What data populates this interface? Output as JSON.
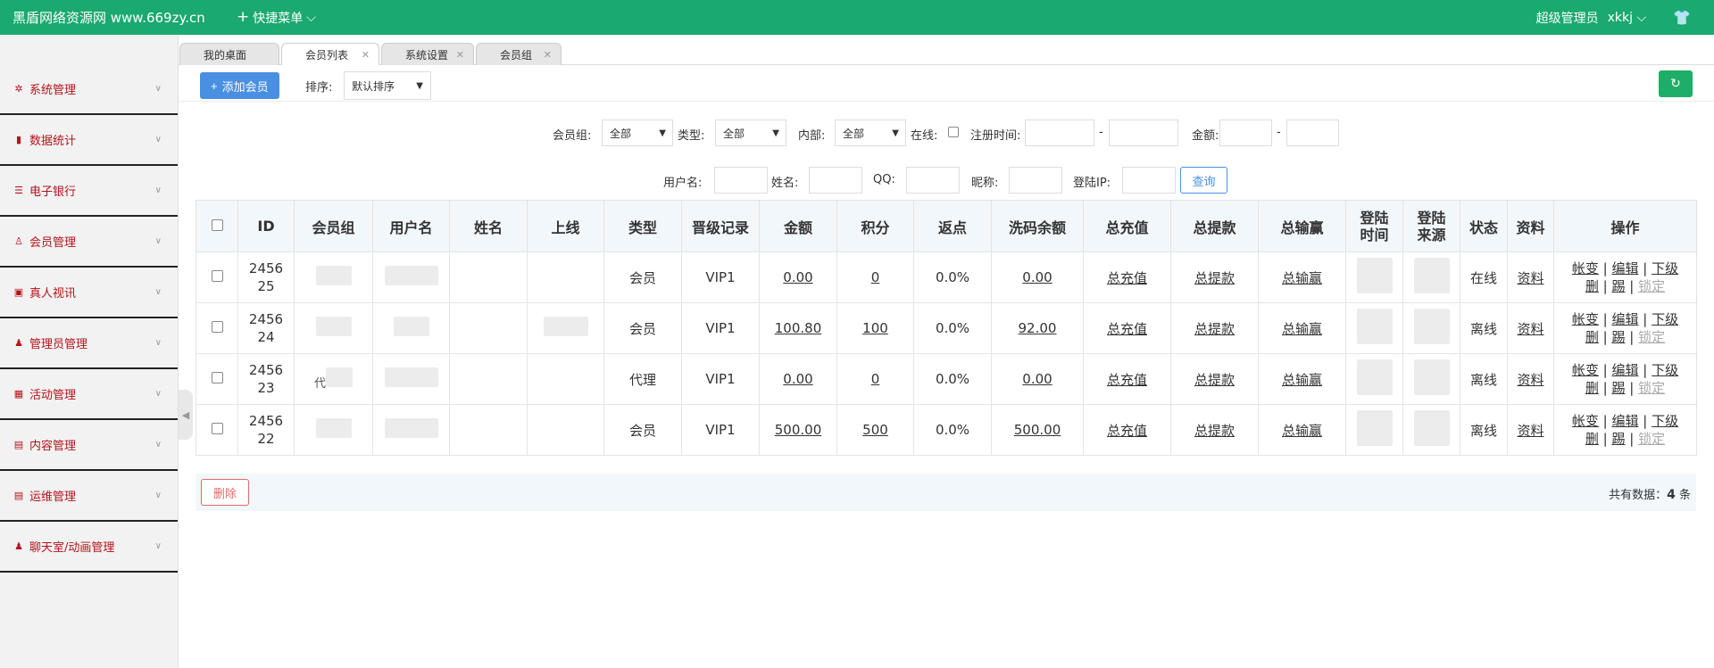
{
  "header": {
    "brand": "黑盾网络资源网 www.669zy.cn",
    "quick_menu": "快捷菜单",
    "role": "超级管理员",
    "username": "xkkj",
    "accent_color": "#1aa96e"
  },
  "sidebar": {
    "items": [
      {
        "label": "系统管理",
        "icon": "gear-icon"
      },
      {
        "label": "数据统计",
        "icon": "bar-chart-icon"
      },
      {
        "label": "电子银行",
        "icon": "list-icon"
      },
      {
        "label": "会员管理",
        "icon": "user-icon"
      },
      {
        "label": "真人视讯",
        "icon": "video-icon"
      },
      {
        "label": "管理员管理",
        "icon": "admin-icon"
      },
      {
        "label": "活动管理",
        "icon": "gift-icon"
      },
      {
        "label": "内容管理",
        "icon": "document-icon"
      },
      {
        "label": "运维管理",
        "icon": "server-icon"
      },
      {
        "label": "聊天室/动画管理",
        "icon": "chat-icon"
      }
    ]
  },
  "tabs": [
    {
      "label": "我的桌面"
    },
    {
      "label": "会员列表"
    },
    {
      "label": "系统设置"
    },
    {
      "label": "会员组"
    }
  ],
  "toolbar": {
    "add_label": "添加会员",
    "sort_label": "排序:",
    "sort_value": "默认排序"
  },
  "filters": {
    "group_label": "会员组:",
    "group_value": "全部",
    "type_label": "类型:",
    "type_value": "全部",
    "internal_label": "内部:",
    "internal_value": "全部",
    "online_label": "在线:",
    "regtime_label": "注册时间:",
    "dash": "-",
    "amount_label": "金额:",
    "username_label": "用户名:",
    "name_label": "姓名:",
    "qq_label": "QQ:",
    "nickname_label": "昵称:",
    "loginip_label": "登陆IP:",
    "query_label": "查询"
  },
  "table": {
    "headers": [
      "ID",
      "会员组",
      "用户名",
      "姓名",
      "上线",
      "类型",
      "晋级记录",
      "金额",
      "积分",
      "返点",
      "洗码余额",
      "总充值",
      "总提款",
      "总输赢",
      "登陆时间",
      "登陆来源",
      "状态",
      "资料",
      "操作"
    ],
    "rows": [
      {
        "id": "245625",
        "type": "会员",
        "level": "VIP1",
        "amount": "0.00",
        "points": "0",
        "rebate": "0.0%",
        "wash": "0.00",
        "recharge": "总充值",
        "withdraw": "总提款",
        "winloss": "总输赢",
        "status": "在线",
        "profile": "资料"
      },
      {
        "id": "245624",
        "type": "会员",
        "level": "VIP1",
        "amount": "100.80",
        "points": "100",
        "rebate": "0.0%",
        "wash": "92.00",
        "recharge": "总充值",
        "withdraw": "总提款",
        "winloss": "总输赢",
        "status": "离线",
        "profile": "资料"
      },
      {
        "id": "245623",
        "type": "代理",
        "level": "VIP1",
        "amount": "0.00",
        "points": "0",
        "rebate": "0.0%",
        "wash": "0.00",
        "recharge": "总充值",
        "withdraw": "总提款",
        "winloss": "总输赢",
        "status": "离线",
        "profile": "资料"
      },
      {
        "id": "245622",
        "type": "会员",
        "level": "VIP1",
        "amount": "500.00",
        "points": "500",
        "rebate": "0.0%",
        "wash": "500.00",
        "recharge": "总充值",
        "withdraw": "总提款",
        "winloss": "总输赢",
        "status": "离线",
        "profile": "资料"
      }
    ],
    "ops": {
      "account": "帐变",
      "edit": "编辑",
      "sub": "下级",
      "delete": "删",
      "kick": "踢",
      "lock": "锁定",
      "sep": "|"
    },
    "row3_group_char": "代"
  },
  "footer": {
    "delete_label": "删除",
    "total_prefix": "共有数据：",
    "total_count": "4",
    "total_suffix": "条"
  }
}
